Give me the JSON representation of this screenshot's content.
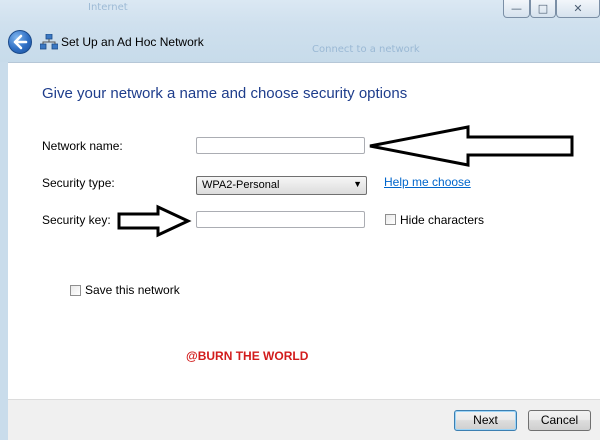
{
  "window": {
    "title": "Set Up an Ad Hoc Network",
    "bg_text_left": "Internet",
    "bg_text_right": "Connect to a network",
    "controls": {
      "minimize": "—",
      "maximize": "□",
      "close": "✕"
    }
  },
  "page": {
    "heading": "Give your network a name and choose security options",
    "network_name": {
      "label": "Network name:",
      "value": ""
    },
    "security_type": {
      "label": "Security type:",
      "selected": "WPA2-Personal",
      "help_link": "Help me choose"
    },
    "security_key": {
      "label": "Security key:",
      "value": "",
      "hide_label": "Hide characters",
      "hide_checked": false
    },
    "save_network": {
      "label": "Save this network",
      "checked": false
    },
    "watermark": "@BURN THE WORLD"
  },
  "footer": {
    "next": "Next",
    "cancel": "Cancel"
  },
  "colors": {
    "heading": "#1e3d8c",
    "link": "#0066cc",
    "watermark": "#d21c1c",
    "glass": "#c9dceb"
  },
  "icons": [
    "back-arrow-icon",
    "network-icon",
    "dropdown-arrow-icon"
  ]
}
